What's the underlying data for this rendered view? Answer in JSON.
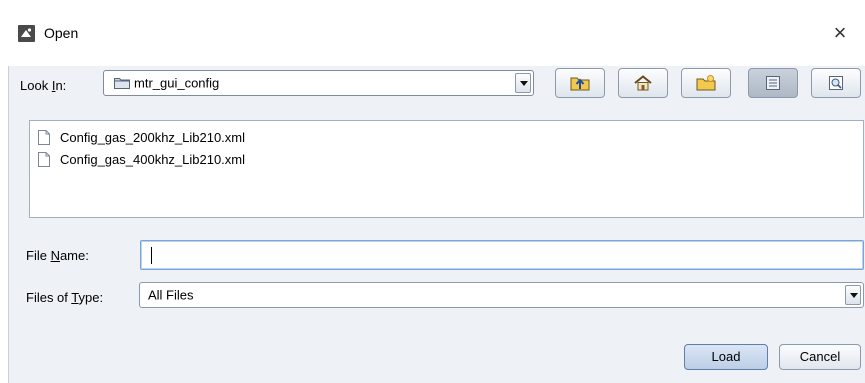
{
  "window": {
    "title": "Open",
    "close_glyph": "×"
  },
  "look_in": {
    "label_prefix": "Look ",
    "label_mnemonic": "I",
    "label_suffix": "n:",
    "value": "mtr_gui_config"
  },
  "toolbar": {
    "buttons": [
      {
        "name": "up-one-level",
        "icon": "folder-up-icon"
      },
      {
        "name": "home",
        "icon": "home-icon"
      },
      {
        "name": "new-folder",
        "icon": "new-folder-icon"
      },
      {
        "name": "list-view",
        "icon": "list-view-icon",
        "pressed": true
      },
      {
        "name": "details-view",
        "icon": "details-view-icon",
        "pressed": false
      }
    ]
  },
  "files": [
    {
      "name": "Config_gas_200khz_Lib210.xml",
      "icon": "document-icon"
    },
    {
      "name": "Config_gas_400khz_Lib210.xml",
      "icon": "document-icon"
    }
  ],
  "file_name": {
    "label_prefix": "File ",
    "label_mnemonic": "N",
    "label_suffix": "ame:",
    "value": ""
  },
  "file_type": {
    "label_prefix": "Files of ",
    "label_mnemonic": "T",
    "label_suffix": "ype:",
    "value": "All Files"
  },
  "buttons": {
    "load": "Load",
    "cancel": "Cancel"
  },
  "colors": {
    "client_bg": "#eef2f7",
    "accent_border": "#7aa3d6",
    "primary_button": "#bccee6"
  }
}
